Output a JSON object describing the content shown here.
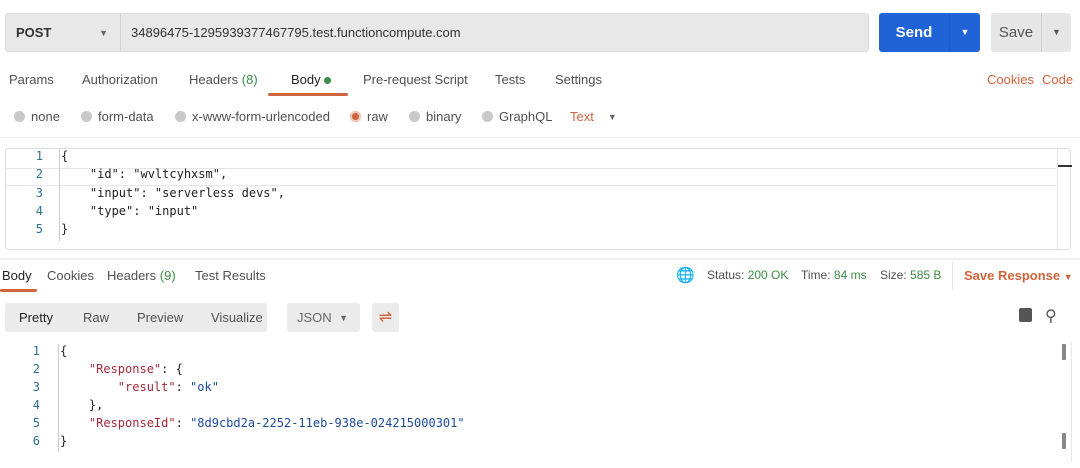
{
  "request": {
    "method": "POST",
    "url": "34896475-1295939377467795.test.functioncompute.com",
    "send_label": "Send",
    "save_label": "Save"
  },
  "request_tabs": [
    {
      "label": "Params"
    },
    {
      "label": "Authorization"
    },
    {
      "label": "Headers",
      "count": "(8)"
    },
    {
      "label": "Body"
    },
    {
      "label": "Pre-request Script"
    },
    {
      "label": "Tests"
    },
    {
      "label": "Settings"
    }
  ],
  "links": {
    "cookies": "Cookies",
    "code": "Code"
  },
  "body_types": [
    {
      "label": "none"
    },
    {
      "label": "form-data"
    },
    {
      "label": "x-www-form-urlencoded"
    },
    {
      "label": "raw",
      "selected": true
    },
    {
      "label": "binary"
    },
    {
      "label": "GraphQL"
    }
  ],
  "raw_format": "Text",
  "request_body": {
    "line_numbers": [
      "1",
      "2",
      "3",
      "4",
      "5"
    ],
    "lines": [
      [
        [
          "p",
          "{"
        ]
      ],
      [
        [
          "p",
          "    \"id\": \"wvltcyhxsm\","
        ]
      ],
      [
        [
          "p",
          "    \"input\": \"serverless devs\","
        ]
      ],
      [
        [
          "p",
          "    \"type\": \"input\""
        ]
      ],
      [
        [
          "p",
          "}"
        ]
      ]
    ]
  },
  "response_tabs": [
    {
      "label": "Body"
    },
    {
      "label": "Cookies"
    },
    {
      "label": "Headers",
      "count": "(9)"
    },
    {
      "label": "Test Results"
    }
  ],
  "status": {
    "status_label": "Status:",
    "status_value": "200 OK",
    "time_label": "Time:",
    "time_value": "84 ms",
    "size_label": "Size:",
    "size_value": "585 B",
    "save_response": "Save Response"
  },
  "view_modes": [
    "Pretty",
    "Raw",
    "Preview",
    "Visualize"
  ],
  "response_format": "JSON",
  "response_body": {
    "line_numbers": [
      "1",
      "2",
      "3",
      "4",
      "5",
      "6"
    ],
    "lines": [
      [
        [
          "p",
          "{"
        ]
      ],
      [
        [
          "p",
          "    "
        ],
        [
          "k",
          "\"Response\""
        ],
        [
          "p",
          ": {"
        ]
      ],
      [
        [
          "p",
          "        "
        ],
        [
          "k",
          "\"result\""
        ],
        [
          "p",
          ": "
        ],
        [
          "s",
          "\"ok\""
        ]
      ],
      [
        [
          "p",
          "    },"
        ]
      ],
      [
        [
          "p",
          "    "
        ],
        [
          "k",
          "\"ResponseId\""
        ],
        [
          "p",
          ": "
        ],
        [
          "s",
          "\"8d9cbd2a-2252-11eb-938e-024215000301\""
        ]
      ],
      [
        [
          "p",
          "}"
        ]
      ]
    ]
  },
  "colors": {
    "accent": "#d0643c",
    "send": "#1f63d6",
    "success": "#3c8c46"
  }
}
